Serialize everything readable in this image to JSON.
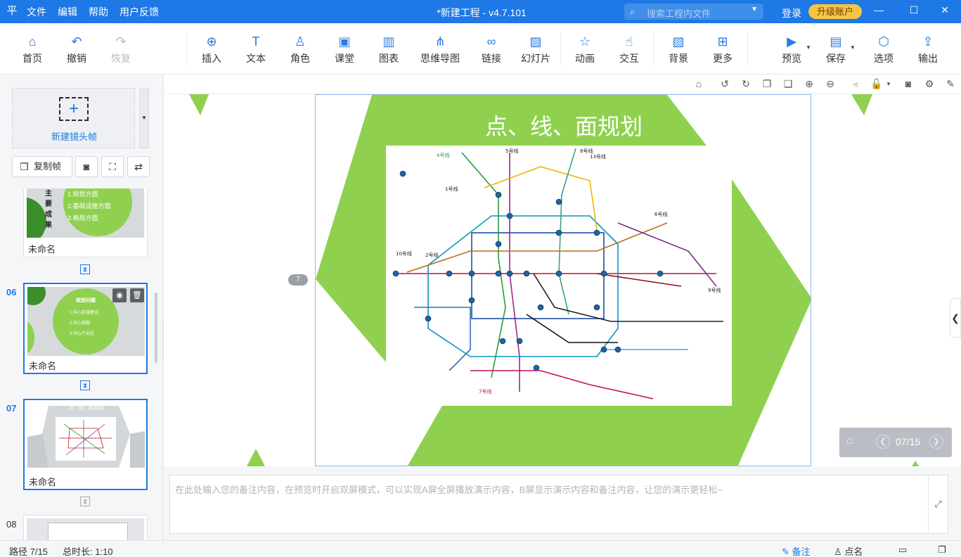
{
  "app": {
    "logo": "平",
    "menu": [
      "文件",
      "编辑",
      "帮助",
      "用户反馈"
    ],
    "title": "*新建工程 - v4.7.101",
    "search_placeholder": "搜索工程内文件",
    "login": "登录",
    "upgrade": "升级账户"
  },
  "toolbar": {
    "home": "首页",
    "undo": "撤销",
    "redo": "恢复",
    "insert": "插入",
    "text": "文本",
    "role": "角色",
    "classroom": "课堂",
    "chart": "图表",
    "mindmap": "思维导图",
    "link": "链接",
    "slideshow": "幻灯片",
    "animation": "动画",
    "interaction": "交互",
    "background": "背景",
    "more": "更多",
    "preview": "预览",
    "save": "保存",
    "options": "选项",
    "export": "输出"
  },
  "left": {
    "new_frame": "新建镜头帧",
    "copy_frame": "复制帧",
    "slides": [
      {
        "num": "",
        "name": "未命名",
        "thumb_lines": [
          "主",
          "要",
          "成",
          "果"
        ],
        "thumb_items": [
          "1.规划方面",
          "2.基础设施方面",
          "3.格局方面"
        ]
      },
      {
        "num": "06",
        "name": "未命名",
        "thumb_title": "规划问题",
        "thumb_items": [
          "1.中心区域建设",
          "2.中心商圈",
          "3.中心产业区"
        ]
      },
      {
        "num": "07",
        "name": "未命名",
        "thumb_title": "点、线、面规划"
      },
      {
        "num": "08",
        "name": ""
      }
    ]
  },
  "canvas": {
    "slide_title": "点、线、面规划",
    "page_badge": "7",
    "nav_counter": "07/15",
    "map_labels": [
      "1号线",
      "2号线",
      "4号线",
      "5号线",
      "6号线",
      "7号线",
      "8号线",
      "9号线",
      "10号线",
      "13号线"
    ]
  },
  "notes": {
    "placeholder": "在此处输入您的备注内容，在预览时开启双屏模式，可以实现A屏全屏播放演示内容，B屏显示演示内容和备注内容，让您的演示更轻松~"
  },
  "status": {
    "path": "路径 7/15",
    "total": "总时长: 1:10",
    "notes_btn": "备注",
    "rollcall": "点名"
  },
  "colors": {
    "brand": "#1e78e6",
    "slide_green": "#8fd14f",
    "upgrade": "#f7c443"
  }
}
